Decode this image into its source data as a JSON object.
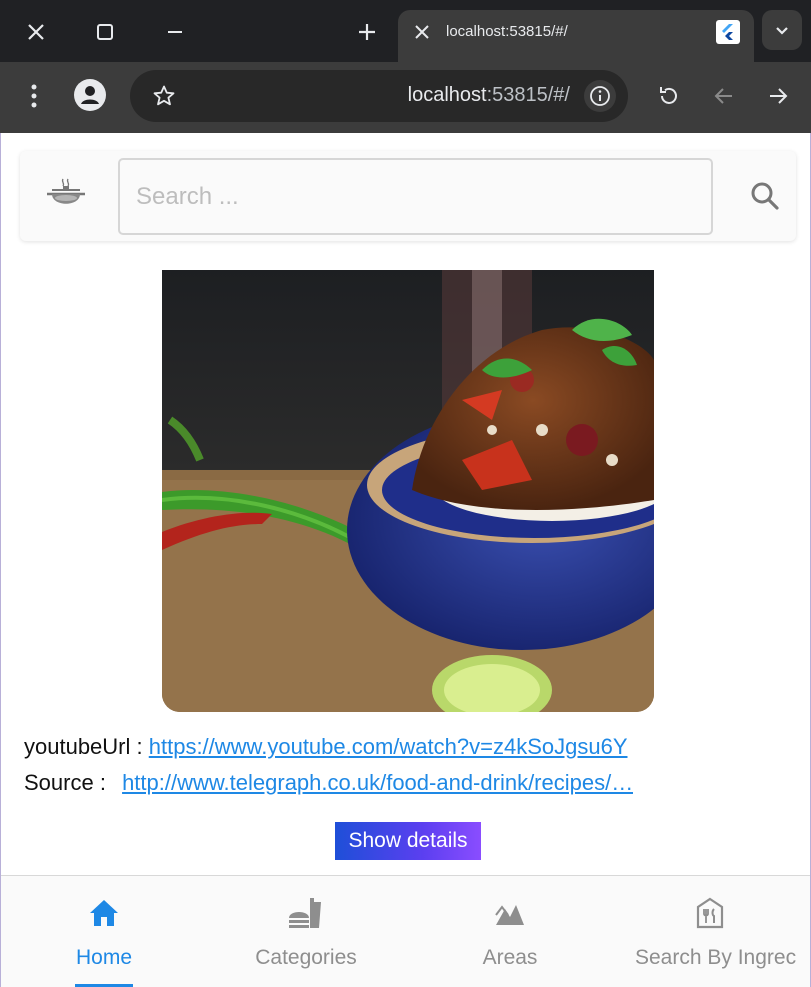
{
  "browser": {
    "tab_title": "localhost:53815/#/",
    "url_host": "localhost",
    "url_path": ":53815/#/"
  },
  "appbar": {
    "search_placeholder": "Search ..."
  },
  "meal": {
    "youtube_label": "youtubeUrl :",
    "youtube_url": "https://www.youtube.com/watch?v=z4kSoJgsu6Y",
    "source_label": "Source :",
    "source_url": "http://www.telegraph.co.uk/food-and-drink/recipes/…",
    "details_button": "Show details"
  },
  "bottom_nav": {
    "items": [
      {
        "label": "Home",
        "icon": "home-icon"
      },
      {
        "label": "Categories",
        "icon": "fastfood-icon"
      },
      {
        "label": "Areas",
        "icon": "landscape-icon"
      },
      {
        "label": "Search By Ingrec",
        "icon": "restaurant-icon"
      }
    ],
    "active_index": 0
  },
  "colors": {
    "accent": "#1e88e5",
    "button_start": "#1e4fd8",
    "button_end": "#8a4dff",
    "chrome_dark": "#202124",
    "chrome_toolbar": "#3c3c3c"
  }
}
